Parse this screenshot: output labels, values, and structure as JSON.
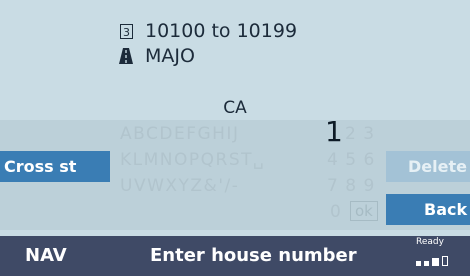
{
  "address": {
    "range_icon": "number-plate-icon",
    "range_text": "10100 to 10199",
    "street_icon": "street-road-icon",
    "street_text": "MAJO",
    "state": "CA"
  },
  "keyboard": {
    "letters_row1": "ABCDEFGHIJ",
    "letters_row2": "KLMNOPQRST␣",
    "letters_row3": "UVWXYZ&'/-",
    "entered_digit": "1",
    "digits_row1": "2 3",
    "digits_row2": "4 5 6",
    "digits_row3": "7 8 9",
    "digits_row4": "0",
    "ok_label": "ok"
  },
  "buttons": {
    "cross_street": "Cross st",
    "delete": "Delete",
    "back": "Back"
  },
  "status_bar": {
    "mode": "NAV",
    "prompt": "Enter house number",
    "ready_label": "Ready"
  },
  "colors": {
    "accent_blue": "#3a7db4",
    "status_bar": "#3f4a66",
    "background": "#c9dce4",
    "disabled_text": "#b1c4cd"
  }
}
